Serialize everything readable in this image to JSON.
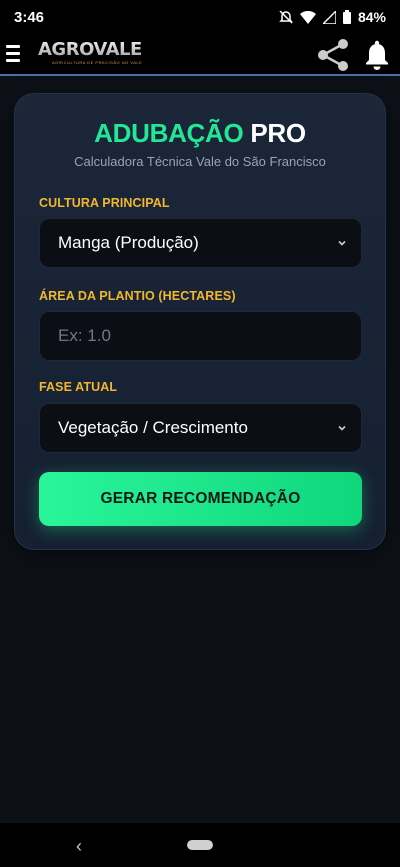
{
  "status_bar": {
    "time": "3:46",
    "battery": "84%",
    "icons": [
      "mute-icon",
      "wifi-icon",
      "signal-icon",
      "battery-icon"
    ]
  },
  "header": {
    "logo_text": "AGROVALE",
    "logo_subtext": "AGRICULTURA DE PRECISÃO NO VALE",
    "icons": [
      "menu-icon",
      "share-icon",
      "bell-icon"
    ]
  },
  "card": {
    "title_part1": "ADUBAÇÃO",
    "title_part2": "PRO",
    "subtitle": "Calculadora Técnica Vale do São Francisco",
    "fields": {
      "culture": {
        "label": "CULTURA PRINCIPAL",
        "value": "Manga (Produção)"
      },
      "area": {
        "label": "ÁREA DA PLANTIO (HECTARES)",
        "placeholder": "Ex: 1.0"
      },
      "phase": {
        "label": "FASE ATUAL",
        "value": "Vegetação / Crescimento"
      }
    },
    "button_label": "GERAR RECOMENDAÇÃO"
  },
  "nav_bar": {
    "back_glyph": "‹"
  },
  "colors": {
    "accent_green": "#22e896",
    "label_gold": "#f2b72e",
    "card_bg": "#1b2739",
    "page_bg": "#0d1117"
  }
}
